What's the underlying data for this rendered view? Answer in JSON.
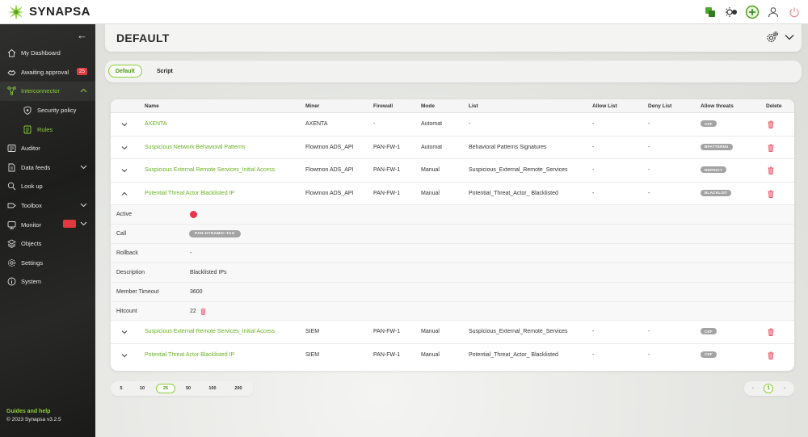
{
  "app": {
    "logo_text": "SYNAPSA",
    "brand_color": "#8ccf3a"
  },
  "header": {
    "title": "DEFAULT"
  },
  "sidebar": {
    "items": [
      {
        "label": "My Dashboard"
      },
      {
        "label": "Awaiting approval",
        "badge": "25"
      },
      {
        "label": "Interconnector"
      },
      {
        "label": "Security policy"
      },
      {
        "label": "Rules"
      },
      {
        "label": "Auditor"
      },
      {
        "label": "Data feeds"
      },
      {
        "label": "Look up"
      },
      {
        "label": "Toolbox"
      },
      {
        "label": "Monitor"
      },
      {
        "label": "Objects"
      },
      {
        "label": "Settings"
      },
      {
        "label": "System"
      }
    ],
    "help": "Guides and help",
    "copyright": "© 2023 Synapsa v3.2.5"
  },
  "tabs": [
    {
      "label": "Default"
    },
    {
      "label": "Script"
    }
  ],
  "table": {
    "headers": {
      "name": "Name",
      "miner": "Miner",
      "firewall": "Firewall",
      "mode": "Mode",
      "list": "List",
      "allow_list": "Allow List",
      "deny_list": "Deny List",
      "allow_threats": "Allow threats",
      "delete": "Delete"
    },
    "rows": [
      {
        "name": "AXENTA",
        "miner": "AXENTA",
        "firewall": "-",
        "mode": "Automat",
        "list": "-",
        "allow_list": "-",
        "deny_list": "-",
        "threat": "CEF"
      },
      {
        "name": "Suspicious Network Behavioral Patterns",
        "miner": "Flowmon ADS_API",
        "firewall": "PAN-FW-1",
        "mode": "Automat",
        "list": "Behavioral Patterns Signatures",
        "allow_list": "-",
        "deny_list": "-",
        "threat": "BPATTERNS"
      },
      {
        "name": "Suspicious External Remote Services_Initial Access",
        "miner": "Flowmon ADS_API",
        "firewall": "PAN-FW-1",
        "mode": "Manual",
        "list": "Suspicious_External_Remote_Services",
        "allow_list": "-",
        "deny_list": "-",
        "threat": "RDPDICT"
      },
      {
        "name": "Potential Threat Actor Blacklisted IP",
        "miner": "Flowmon ADS_API",
        "firewall": "PAN-FW-1",
        "mode": "Manual",
        "list": "Potential_Threat_Actor_ Blacklisted",
        "allow_list": "-",
        "deny_list": "-",
        "threat": "BLACKLIST"
      },
      {
        "name": "Suspicious External Remote Services_Initial Access",
        "miner": "SIEM",
        "firewall": "PAN-FW-1",
        "mode": "Manual",
        "list": "Suspicious_External_Remote_Services",
        "allow_list": "-",
        "deny_list": "-",
        "threat": "CEF"
      },
      {
        "name": "Potential Threat Actor Blacklisted IP",
        "miner": "SIEM",
        "firewall": "PAN-FW-1",
        "mode": "Manual",
        "list": "Potential_Threat_Actor_ Blacklisted",
        "allow_list": "-",
        "deny_list": "-",
        "threat": "CEF"
      }
    ],
    "detail": {
      "active_label": "Active",
      "call_label": "Call",
      "call_value": "PAN-DYNAMIC-TAG",
      "rollback_label": "Rollback",
      "rollback_value": "-",
      "description_label": "Description",
      "description_value": "Blacklisted IPs",
      "timeout_label": "Member Timeout",
      "timeout_value": "3600",
      "hitcount_label": "Hitcount",
      "hitcount_value": "22"
    }
  },
  "pagination": {
    "sizes": [
      "5",
      "10",
      "25",
      "50",
      "100",
      "200"
    ],
    "active_size": "25",
    "prev": "‹",
    "page": "1",
    "next": "›"
  }
}
